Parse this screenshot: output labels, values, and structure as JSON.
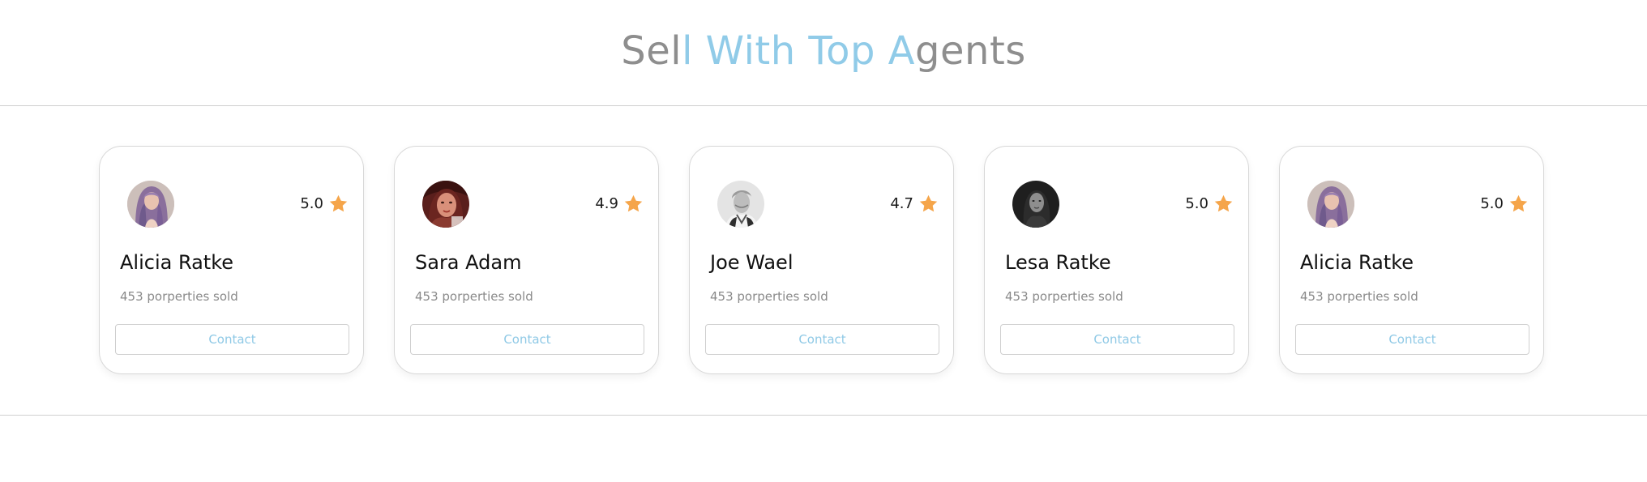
{
  "section": {
    "title_parts": [
      "Sel",
      "l With Top A",
      "gents"
    ]
  },
  "colors": {
    "accent": "#90cbe8",
    "title_gray": "#8e8e8e",
    "star": "#f5a54a"
  },
  "agents": [
    {
      "name": "Alicia Ratke",
      "rating": "5.0",
      "sold": "453 porperties sold",
      "contact_label": "Contact",
      "avatar_icon": "purple-hair-avatar-icon"
    },
    {
      "name": "Sara Adam",
      "rating": "4.9",
      "sold": "453 porperties sold",
      "contact_label": "Contact",
      "avatar_icon": "red-tone-avatar-icon"
    },
    {
      "name": "Joe Wael",
      "rating": "4.7",
      "sold": "453 porperties sold",
      "contact_label": "Contact",
      "avatar_icon": "grayscale-man-avatar-icon"
    },
    {
      "name": "Lesa Ratke",
      "rating": "5.0",
      "sold": "453 porperties sold",
      "contact_label": "Contact",
      "avatar_icon": "dark-avatar-icon"
    },
    {
      "name": "Alicia Ratke",
      "rating": "5.0",
      "sold": "453 porperties sold",
      "contact_label": "Contact",
      "avatar_icon": "purple-hair-avatar-icon"
    }
  ]
}
